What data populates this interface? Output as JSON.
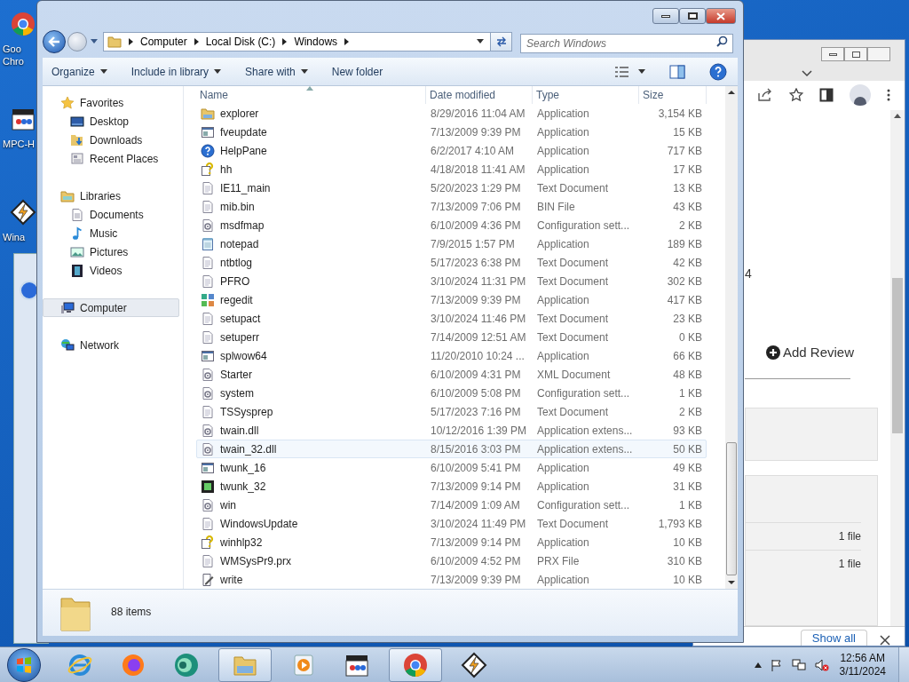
{
  "desktop": {
    "icons": [
      {
        "kind": "chrome",
        "lines": [
          "Goo",
          "Chro"
        ]
      },
      {
        "kind": "mpc",
        "lines": [
          "MPC-H"
        ]
      },
      {
        "kind": "winamp",
        "lines": [
          "Wina"
        ]
      }
    ]
  },
  "browser": {
    "partial_text": "4",
    "add_review": "Add Review",
    "file_counts": [
      "1 file",
      "1 file"
    ],
    "show_all": "Show all"
  },
  "explorer": {
    "address": [
      "Computer",
      "Local Disk (C:)",
      "Windows"
    ],
    "search": {
      "placeholder": "Search Windows"
    },
    "toolbar": [
      {
        "label": "Organize",
        "menu": true
      },
      {
        "label": "Include in library",
        "menu": true
      },
      {
        "label": "Share with",
        "menu": true
      },
      {
        "label": "New folder",
        "menu": false
      }
    ],
    "nav": [
      {
        "label": "Favorites",
        "kind": "star",
        "selected": false,
        "children": [
          {
            "label": "Desktop",
            "kind": "desktop",
            "selected": false
          },
          {
            "label": "Downloads",
            "kind": "downloads",
            "selected": false
          },
          {
            "label": "Recent Places",
            "kind": "recent",
            "selected": false
          }
        ]
      },
      {
        "label": "Libraries",
        "kind": "libraries",
        "selected": false,
        "children": [
          {
            "label": "Documents",
            "kind": "document",
            "selected": false
          },
          {
            "label": "Music",
            "kind": "music",
            "selected": false
          },
          {
            "label": "Pictures",
            "kind": "pictures",
            "selected": false
          },
          {
            "label": "Videos",
            "kind": "videos",
            "selected": false
          }
        ]
      },
      {
        "label": "Computer",
        "kind": "computer",
        "selected": true
      },
      {
        "label": "Network",
        "kind": "network",
        "selected": false
      }
    ],
    "columns": [
      "Name",
      "Date modified",
      "Type",
      "Size"
    ],
    "rows": [
      {
        "name": "explorer",
        "date": "8/29/2016 11:04 AM",
        "type": "Application",
        "size": "3,154 KB",
        "kind": "folder",
        "selected": false,
        "hovered": false
      },
      {
        "name": "fveupdate",
        "date": "7/13/2009 9:39 PM",
        "type": "Application",
        "size": "15 KB",
        "kind": "window",
        "selected": false,
        "hovered": false
      },
      {
        "name": "HelpPane",
        "date": "6/2/2017 4:10 AM",
        "type": "Application",
        "size": "717 KB",
        "kind": "help",
        "selected": false,
        "hovered": false
      },
      {
        "name": "hh",
        "date": "4/18/2018 11:41 AM",
        "type": "Application",
        "size": "17 KB",
        "kind": "helpdoc",
        "selected": false,
        "hovered": false
      },
      {
        "name": "IE11_main",
        "date": "5/20/2023 1:29 PM",
        "type": "Text Document",
        "size": "13 KB",
        "kind": "document",
        "selected": false,
        "hovered": false
      },
      {
        "name": "mib.bin",
        "date": "7/13/2009 7:06 PM",
        "type": "BIN File",
        "size": "43 KB",
        "kind": "document",
        "selected": false,
        "hovered": false
      },
      {
        "name": "msdfmap",
        "date": "6/10/2009 4:36 PM",
        "type": "Configuration sett...",
        "size": "2 KB",
        "kind": "settings",
        "selected": false,
        "hovered": false
      },
      {
        "name": "notepad",
        "date": "7/9/2015 1:57 PM",
        "type": "Application",
        "size": "189 KB",
        "kind": "notepad",
        "selected": false,
        "hovered": false
      },
      {
        "name": "ntbtlog",
        "date": "5/17/2023 6:38 PM",
        "type": "Text Document",
        "size": "42 KB",
        "kind": "document",
        "selected": false,
        "hovered": false
      },
      {
        "name": "PFRO",
        "date": "3/10/2024 11:31 PM",
        "type": "Text Document",
        "size": "302 KB",
        "kind": "document",
        "selected": false,
        "hovered": false
      },
      {
        "name": "regedit",
        "date": "7/13/2009 9:39 PM",
        "type": "Application",
        "size": "417 KB",
        "kind": "registry",
        "selected": false,
        "hovered": false
      },
      {
        "name": "setupact",
        "date": "3/10/2024 11:46 PM",
        "type": "Text Document",
        "size": "23 KB",
        "kind": "document",
        "selected": false,
        "hovered": false
      },
      {
        "name": "setuperr",
        "date": "7/14/2009 12:51 AM",
        "type": "Text Document",
        "size": "0 KB",
        "kind": "document",
        "selected": false,
        "hovered": false
      },
      {
        "name": "splwow64",
        "date": "11/20/2010 10:24 ...",
        "type": "Application",
        "size": "66 KB",
        "kind": "window",
        "selected": false,
        "hovered": false
      },
      {
        "name": "Starter",
        "date": "6/10/2009 4:31 PM",
        "type": "XML Document",
        "size": "48 KB",
        "kind": "settings",
        "selected": false,
        "hovered": false
      },
      {
        "name": "system",
        "date": "6/10/2009 5:08 PM",
        "type": "Configuration sett...",
        "size": "1 KB",
        "kind": "settings",
        "selected": false,
        "hovered": false
      },
      {
        "name": "TSSysprep",
        "date": "5/17/2023 7:16 PM",
        "type": "Text Document",
        "size": "2 KB",
        "kind": "document",
        "selected": false,
        "hovered": false
      },
      {
        "name": "twain.dll",
        "date": "10/12/2016 1:39 PM",
        "type": "Application extens...",
        "size": "93 KB",
        "kind": "settings",
        "selected": false,
        "hovered": false
      },
      {
        "name": "twain_32.dll",
        "date": "8/15/2016 3:03 PM",
        "type": "Application extens...",
        "size": "50 KB",
        "kind": "settings",
        "selected": false,
        "hovered": true
      },
      {
        "name": "twunk_16",
        "date": "6/10/2009 5:41 PM",
        "type": "Application",
        "size": "49 KB",
        "kind": "window",
        "selected": false,
        "hovered": false
      },
      {
        "name": "twunk_32",
        "date": "7/13/2009 9:14 PM",
        "type": "Application",
        "size": "31 KB",
        "kind": "film",
        "selected": false,
        "hovered": false
      },
      {
        "name": "win",
        "date": "7/14/2009 1:09 AM",
        "type": "Configuration sett...",
        "size": "1 KB",
        "kind": "settings",
        "selected": false,
        "hovered": false
      },
      {
        "name": "WindowsUpdate",
        "date": "3/10/2024 11:49 PM",
        "type": "Text Document",
        "size": "1,793 KB",
        "kind": "document",
        "selected": false,
        "hovered": false
      },
      {
        "name": "winhlp32",
        "date": "7/13/2009 9:14 PM",
        "type": "Application",
        "size": "10 KB",
        "kind": "helpdoc",
        "selected": false,
        "hovered": false
      },
      {
        "name": "WMSysPr9.prx",
        "date": "6/10/2009 4:52 PM",
        "type": "PRX File",
        "size": "310 KB",
        "kind": "document",
        "selected": false,
        "hovered": false
      },
      {
        "name": "write",
        "date": "7/13/2009 9:39 PM",
        "type": "Application",
        "size": "10 KB",
        "kind": "write",
        "selected": false,
        "hovered": false
      }
    ],
    "status": "88 items"
  },
  "taskbar": {
    "apps": [
      {
        "kind": "ie",
        "open": false
      },
      {
        "kind": "firefox",
        "open": false
      },
      {
        "kind": "teal",
        "open": false
      },
      {
        "kind": "explorer",
        "open": true
      },
      {
        "kind": "media",
        "open": false
      },
      {
        "kind": "mpc",
        "open": false
      },
      {
        "kind": "chrome",
        "open": true
      },
      {
        "kind": "winamp",
        "open": false
      }
    ],
    "clock": {
      "time": "12:56 AM",
      "date": "3/11/2024"
    }
  }
}
